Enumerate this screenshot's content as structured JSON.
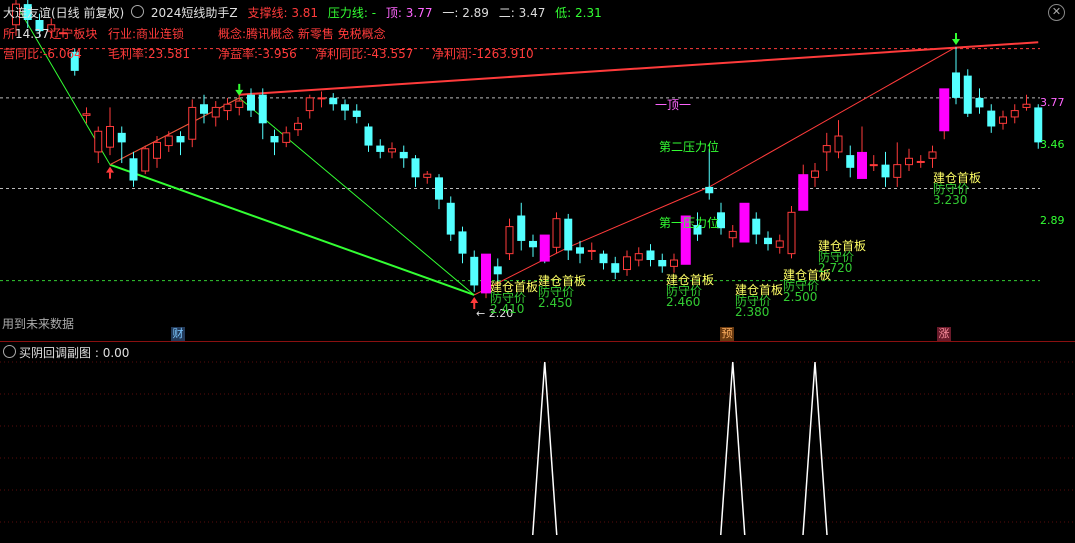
{
  "header": {
    "stock_title": "大连友谊(日线 前复权)",
    "indicator_name": "2024短线助手Z",
    "support_label": "支撑线:",
    "support_value": "3.81",
    "pressure_label": "压力线:",
    "pressure_value": "-",
    "top_label": "顶:",
    "top_value": "3.77",
    "one_label": "一:",
    "one_value": "2.89",
    "two_label": "二:",
    "two_value": "3.47",
    "low_label": "低:",
    "low_value": "2.31",
    "close_icon": "x-icon"
  },
  "info": {
    "row1_prefix": "所",
    "row1_badge": "14.37",
    "row1_region": "辽宁板块",
    "industry": "行业:商业连锁",
    "concept": "概念:腾讯概念 新零售 免税概念",
    "row2_prefix": "营",
    "row2_yoy": "同比:-6.064",
    "gross_margin": "毛利率:23.581",
    "net_rate": "净益率:-3.956",
    "net_profit_yoy": "净利同比:-43.557",
    "net_profit": "净利润:-1263.910"
  },
  "main_chart": {
    "future_data_label": "用到未来数据",
    "level_labels": {
      "top": "一顶一",
      "second_pressure": "第二压力位",
      "first_pressure": "第一压力位"
    },
    "price_axis": [
      "3.77",
      "3.46",
      "2.89"
    ],
    "low_marker": "2.20",
    "event_markers": [
      "财",
      "预",
      "涨"
    ],
    "signals": [
      {
        "label": "建仓首板",
        "sub": "防守价",
        "price": "2.410"
      },
      {
        "label": "建仓首板",
        "sub": "防守价",
        "price": "2.450"
      },
      {
        "label": "建仓首板",
        "sub": "防守价",
        "price": "2.460"
      },
      {
        "label": "建仓首板",
        "sub": "防守价",
        "price": "2.380"
      },
      {
        "label": "建仓首板",
        "sub": "防守价",
        "price": "2.500"
      },
      {
        "label": "建仓首板",
        "sub": "防守价",
        "price": "2.720"
      },
      {
        "label": "建仓首板",
        "sub": "防守价",
        "price": "3.230"
      }
    ]
  },
  "sub_chart": {
    "title": "买阴回调副图",
    "value": "0.00"
  },
  "chart_data": {
    "type": "candlestick",
    "ylim": [
      2.05,
      3.95
    ],
    "levels": {
      "top": 3.77,
      "second": 3.46,
      "first": 2.89,
      "low": 2.31
    },
    "candles": [
      [
        3.92,
        4.05,
        3.85,
        4.08
      ],
      [
        4.05,
        3.95,
        3.9,
        4.1
      ],
      [
        3.95,
        3.88,
        3.84,
        3.99
      ],
      [
        3.88,
        3.92,
        3.84,
        3.96
      ],
      [
        3.87,
        3.87,
        3.84,
        3.9
      ],
      [
        3.75,
        3.63,
        3.6,
        3.77
      ],
      [
        3.35,
        3.36,
        3.3,
        3.4
      ],
      [
        3.12,
        3.25,
        3.05,
        3.28
      ],
      [
        3.15,
        3.28,
        3.1,
        3.4
      ],
      [
        3.24,
        3.18,
        3.05,
        3.28
      ],
      [
        3.08,
        2.94,
        2.9,
        3.12
      ],
      [
        3.0,
        3.14,
        2.98,
        3.16
      ],
      [
        3.08,
        3.18,
        3.02,
        3.22
      ],
      [
        3.16,
        3.22,
        3.12,
        3.25
      ],
      [
        3.22,
        3.18,
        3.1,
        3.25
      ],
      [
        3.2,
        3.4,
        3.15,
        3.45
      ],
      [
        3.42,
        3.36,
        3.3,
        3.48
      ],
      [
        3.34,
        3.4,
        3.28,
        3.44
      ],
      [
        3.38,
        3.42,
        3.32,
        3.46
      ],
      [
        3.4,
        3.44,
        3.35,
        3.48
      ],
      [
        3.48,
        3.38,
        3.34,
        3.52
      ],
      [
        3.48,
        3.3,
        3.2,
        3.52
      ],
      [
        3.22,
        3.18,
        3.1,
        3.26
      ],
      [
        3.18,
        3.24,
        3.15,
        3.28
      ],
      [
        3.26,
        3.3,
        3.22,
        3.34
      ],
      [
        3.38,
        3.46,
        3.33,
        3.48
      ],
      [
        3.46,
        3.46,
        3.4,
        3.5
      ],
      [
        3.46,
        3.42,
        3.38,
        3.49
      ],
      [
        3.42,
        3.38,
        3.32,
        3.45
      ],
      [
        3.38,
        3.34,
        3.3,
        3.42
      ],
      [
        3.28,
        3.16,
        3.12,
        3.3
      ],
      [
        3.16,
        3.12,
        3.08,
        3.2
      ],
      [
        3.12,
        3.14,
        3.08,
        3.18
      ],
      [
        3.12,
        3.08,
        3.02,
        3.16
      ],
      [
        3.08,
        2.96,
        2.9,
        3.1
      ],
      [
        2.96,
        2.98,
        2.92,
        3.0
      ],
      [
        2.96,
        2.82,
        2.76,
        2.98
      ],
      [
        2.8,
        2.6,
        2.56,
        2.84
      ],
      [
        2.62,
        2.48,
        2.42,
        2.65
      ],
      [
        2.46,
        2.28,
        2.24,
        2.5
      ],
      [
        2.28,
        2.4,
        2.2,
        2.44
      ],
      [
        2.4,
        2.35,
        2.3,
        2.45
      ],
      [
        2.48,
        2.65,
        2.44,
        2.7
      ],
      [
        2.72,
        2.56,
        2.5,
        2.8
      ],
      [
        2.56,
        2.52,
        2.46,
        2.6
      ],
      [
        2.52,
        2.48,
        2.42,
        2.56
      ],
      [
        2.52,
        2.7,
        2.48,
        2.74
      ],
      [
        2.7,
        2.5,
        2.44,
        2.73
      ],
      [
        2.52,
        2.48,
        2.42,
        2.56
      ],
      [
        2.5,
        2.5,
        2.44,
        2.55
      ],
      [
        2.48,
        2.42,
        2.38,
        2.5
      ],
      [
        2.42,
        2.36,
        2.32,
        2.46
      ],
      [
        2.38,
        2.46,
        2.34,
        2.5
      ],
      [
        2.44,
        2.48,
        2.4,
        2.52
      ],
      [
        2.5,
        2.44,
        2.4,
        2.54
      ],
      [
        2.44,
        2.4,
        2.36,
        2.48
      ],
      [
        2.4,
        2.44,
        2.36,
        2.48
      ],
      [
        2.46,
        2.64,
        2.42,
        2.68
      ],
      [
        2.66,
        2.6,
        2.56,
        2.74
      ],
      [
        2.9,
        2.86,
        2.82,
        3.14
      ],
      [
        2.74,
        2.64,
        2.6,
        2.8
      ],
      [
        2.58,
        2.62,
        2.52,
        2.66
      ],
      [
        2.6,
        2.72,
        2.56,
        2.76
      ],
      [
        2.7,
        2.6,
        2.54,
        2.74
      ],
      [
        2.58,
        2.54,
        2.5,
        2.62
      ],
      [
        2.52,
        2.56,
        2.48,
        2.6
      ],
      [
        2.48,
        2.74,
        2.45,
        2.78
      ],
      [
        2.8,
        2.9,
        2.76,
        3.04
      ],
      [
        2.96,
        3.0,
        2.9,
        3.05
      ],
      [
        3.12,
        3.16,
        3.0,
        3.24
      ],
      [
        3.12,
        3.22,
        3.08,
        3.32
      ],
      [
        3.1,
        3.02,
        2.96,
        3.16
      ],
      [
        3.0,
        3.04,
        2.96,
        3.28
      ],
      [
        3.04,
        3.04,
        3.0,
        3.1
      ],
      [
        3.04,
        2.96,
        2.9,
        3.12
      ],
      [
        2.96,
        3.04,
        2.9,
        3.18
      ],
      [
        3.04,
        3.08,
        3.0,
        3.14
      ],
      [
        3.06,
        3.06,
        3.02,
        3.1
      ],
      [
        3.08,
        3.12,
        3.02,
        3.16
      ],
      [
        3.3,
        3.44,
        3.2,
        3.48
      ],
      [
        3.62,
        3.46,
        3.42,
        3.78
      ],
      [
        3.6,
        3.36,
        3.34,
        3.64
      ],
      [
        3.46,
        3.4,
        3.36,
        3.52
      ],
      [
        3.38,
        3.28,
        3.24,
        3.42
      ],
      [
        3.3,
        3.34,
        3.26,
        3.38
      ],
      [
        3.34,
        3.38,
        3.3,
        3.42
      ],
      [
        3.4,
        3.42,
        3.38,
        3.48
      ],
      [
        3.4,
        3.18,
        3.14,
        3.42
      ]
    ],
    "sub_series_peaks": [
      45,
      61,
      68
    ]
  }
}
